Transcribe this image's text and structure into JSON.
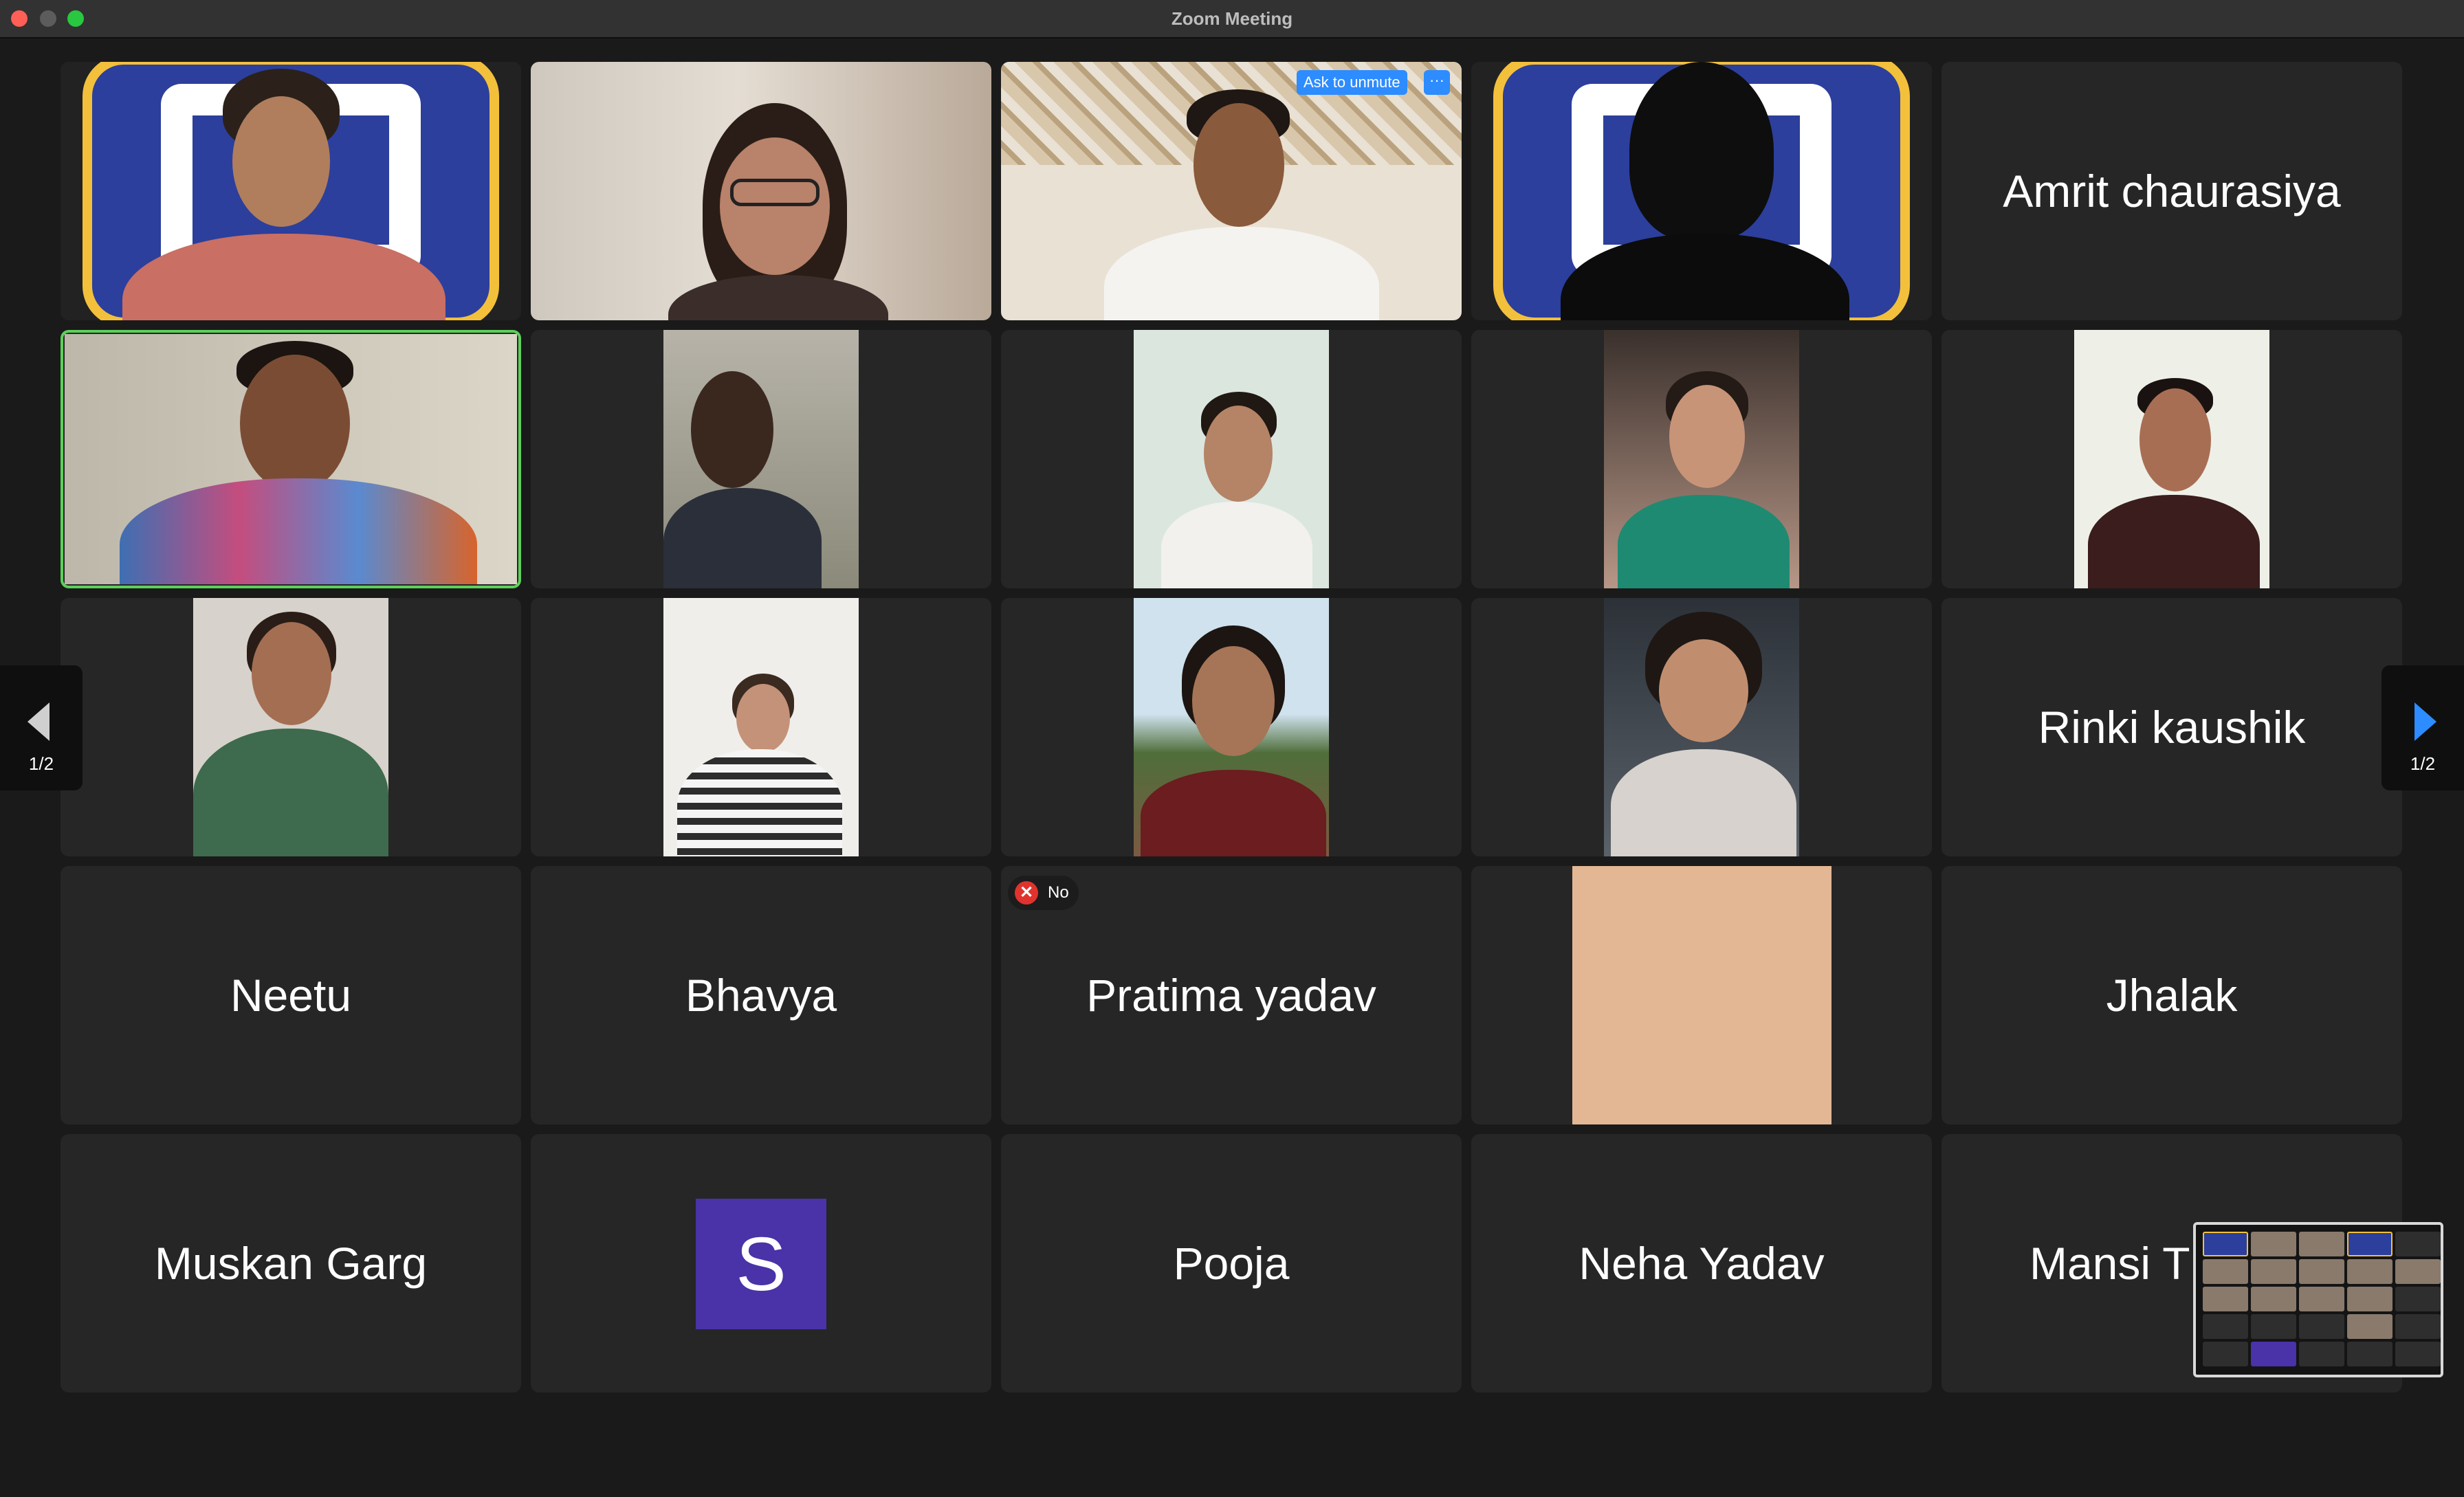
{
  "window": {
    "title": "Zoom Meeting"
  },
  "tiles": {
    "t1": {
      "kind": "video-logo"
    },
    "t2": {
      "kind": "video"
    },
    "t3": {
      "kind": "video",
      "ask_to_unmute_label": "Ask to unmute",
      "more_label": "···"
    },
    "t4": {
      "kind": "video-logo"
    },
    "t5": {
      "name": "Amrit chaurasiya"
    },
    "t6": {
      "kind": "video",
      "active_speaker": true
    },
    "t7": {
      "kind": "video"
    },
    "t8": {
      "kind": "video"
    },
    "t9": {
      "kind": "video"
    },
    "t10": {
      "kind": "video"
    },
    "t11": {
      "kind": "video"
    },
    "t12": {
      "kind": "video"
    },
    "t13": {
      "kind": "video"
    },
    "t14": {
      "kind": "video"
    },
    "t15": {
      "name": "Rinki kaushik"
    },
    "t16": {
      "name": "Neetu"
    },
    "t17": {
      "name": "Bhavya"
    },
    "t18": {
      "name": "Pratima yadav",
      "reaction_label": "No"
    },
    "t19": {
      "kind": "video"
    },
    "t20": {
      "name": "Jhalak"
    },
    "t21": {
      "name": "Muskan Garg"
    },
    "t22": {
      "avatar_letter": "S"
    },
    "t23": {
      "name": "Pooja"
    },
    "t24": {
      "name": "Neha Yadav"
    },
    "t25": {
      "name": "Mansi T"
    }
  },
  "pager": {
    "left_label": "1/2",
    "right_label": "1/2"
  },
  "colors": {
    "accent": "#2d8cff",
    "speaker_border": "#5cd05a",
    "tile_bg": "#262626",
    "avatar_bg": "#4a32a8",
    "no_reaction": "#e0332e"
  }
}
